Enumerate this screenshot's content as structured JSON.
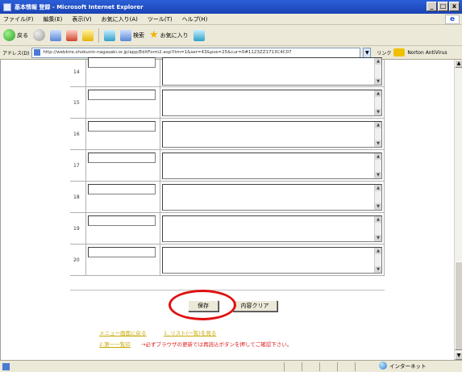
{
  "window": {
    "title": "基本情報 登録 - Microsoft Internet Explorer",
    "min_label": "_",
    "max_label": "□",
    "close_label": "x"
  },
  "menubar": {
    "items": [
      "ファイル(F)",
      "編集(E)",
      "表示(V)",
      "お気に入り(A)",
      "ツール(T)",
      "ヘルプ(H)"
    ]
  },
  "toolbar": {
    "back_label": "戻る",
    "search_label": "検索",
    "favorites_label": "お気に入り"
  },
  "addressbar": {
    "label": "アドレス(D)",
    "url": "http://webkire.shokunin-nagasaki.or.jp/app/EditForm2.asp?itm=1&ser=43&pos=25&cur=0#1123ZZ1713C4C07",
    "links_label": "リンク",
    "norton_label": "Norton",
    "norton_sub": "Norton AntiVirus"
  },
  "form": {
    "rows": [
      "14",
      "15",
      "16",
      "17",
      "18",
      "19",
      "20"
    ],
    "save_label": "保存",
    "clear_label": "内容クリア",
    "links": {
      "menu_back": "メニュー画面に戻る",
      "list": "1. リスト(一覧)を見る",
      "check": "2.第一一覧印"
    },
    "notice": "→必ずブラウザの更新では再読込ボタンを押してご確認下さい。"
  },
  "statusbar": {
    "zone": "インターネット"
  },
  "colors": {
    "title_bar": "#1b43b4",
    "highlight_circle": "#e01010",
    "link": "#c8a800",
    "notice": "#e02020"
  }
}
